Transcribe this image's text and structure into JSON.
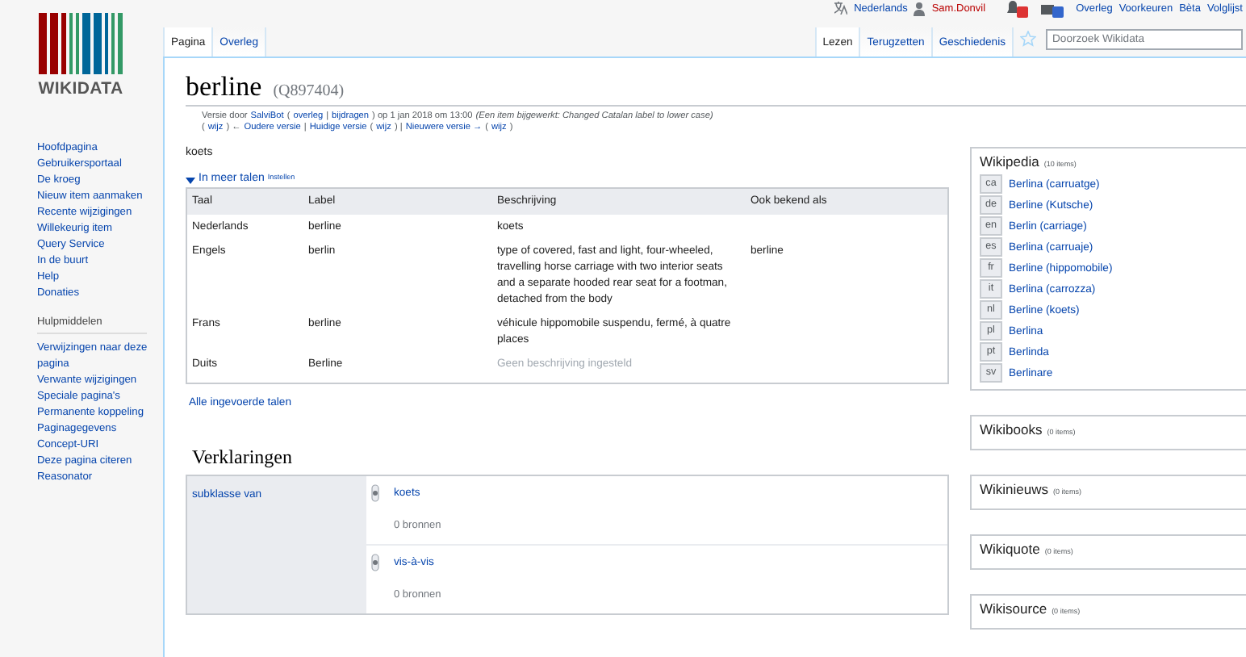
{
  "personal_tools": [
    {
      "kind": "language",
      "label": "Nederlands"
    },
    {
      "kind": "user",
      "label": "Sam.Donvil"
    },
    {
      "kind": "alerts"
    },
    {
      "kind": "notices"
    },
    {
      "kind": "link",
      "label": "Overleg"
    },
    {
      "kind": "link",
      "label": "Voorkeuren"
    },
    {
      "kind": "link",
      "label": "Bèta"
    },
    {
      "kind": "link",
      "label": "Volglijst"
    }
  ],
  "logo": {
    "text": "WIKIDATA"
  },
  "sidebar": {
    "navigation": [
      "Hoofdpagina",
      "Gebruikersportaal",
      "De kroeg",
      "Nieuw item aanmaken",
      "Recente wijzigingen",
      "Willekeurig item",
      "Query Service",
      "In de buurt",
      "Help",
      "Donaties"
    ],
    "tools_heading": "Hulpmiddelen",
    "tools": [
      "Verwijzingen naar deze pagina",
      "Verwante wijzigingen",
      "Speciale pagina's",
      "Permanente koppeling",
      "Paginagegevens",
      "Concept-URI",
      "Deze pagina citeren",
      "Reasonator"
    ]
  },
  "namespace_tabs": [
    {
      "label": "Pagina",
      "selected": true
    },
    {
      "label": "Overleg",
      "selected": false
    }
  ],
  "view_tabs": [
    {
      "label": "Lezen",
      "selected": true
    },
    {
      "label": "Terugzetten",
      "selected": false
    },
    {
      "label": "Geschiedenis",
      "selected": false
    }
  ],
  "watch": {
    "watched": false
  },
  "search": {
    "placeholder": "Doorzoek Wikidata"
  },
  "title": "berline",
  "item_id": "(Q897404)",
  "revision_lines": [
    [
      {
        "kind": "plain",
        "text": "Versie door"
      },
      {
        "kind": "link",
        "text": "SalviBot"
      },
      {
        "kind": "plain",
        "text": "("
      },
      {
        "kind": "link",
        "text": "overleg"
      },
      {
        "kind": "plain",
        "text": "|"
      },
      {
        "kind": "link",
        "text": "bijdragen"
      },
      {
        "kind": "plain",
        "text": ") op 1 jan 2018 om 13:00"
      },
      {
        "kind": "italic",
        "text": "(Een item bijgewerkt: Changed Catalan label to lower case)"
      }
    ],
    [
      {
        "kind": "plain",
        "text": "("
      },
      {
        "kind": "link",
        "text": "wijz"
      },
      {
        "kind": "plain",
        "text": ") ←"
      },
      {
        "kind": "link",
        "text": "Oudere versie"
      },
      {
        "kind": "plain",
        "text": "|"
      },
      {
        "kind": "link",
        "text": "Huidige versie"
      },
      {
        "kind": "plain",
        "text": "("
      },
      {
        "kind": "link",
        "text": "wijz"
      },
      {
        "kind": "plain",
        "text": ") |"
      },
      {
        "kind": "link",
        "text": "Nieuwere versie →"
      },
      {
        "kind": "plain",
        "text": "("
      },
      {
        "kind": "link",
        "text": "wijz"
      },
      {
        "kind": "plain",
        "text": ")"
      }
    ]
  ],
  "description": "koets",
  "terms": {
    "toggle": "In meer talen",
    "expanded": true,
    "settings": "Instellen",
    "columns": [
      "Taal",
      "Label",
      "Beschrijving",
      "Ook bekend als"
    ],
    "rows": [
      {
        "language": "Nederlands",
        "label": "berline",
        "description": "koets",
        "missing": false
      },
      {
        "language": "Engels",
        "label": "berlin",
        "description": "type of covered, fast and light, four-wheeled, travelling horse carriage with two interior seats and a separate hooded rear seat for a footman, detached from the body",
        "aliases": "berline",
        "missing": false
      },
      {
        "language": "Frans",
        "label": "berline",
        "description": "véhicule hippomobile suspendu, fermé, à quatre places",
        "missing": false
      },
      {
        "language": "Duits",
        "label": "Berline",
        "description": "Geen beschrijving ingesteld",
        "missing": true
      }
    ],
    "all_languages": "Alle ingevoerde talen"
  },
  "statements": {
    "heading": "Verklaringen",
    "groups": [
      {
        "property": "subklasse van",
        "values": [
          {
            "value": "koets",
            "references": "0 bronnen"
          },
          {
            "value": "vis-à-vis",
            "references": "0 bronnen"
          }
        ]
      }
    ]
  },
  "sitelink_groups": [
    {
      "name": "Wikipedia",
      "count": "(10 items)",
      "links": [
        {
          "code": "ca",
          "title": "Berlina (carruatge)"
        },
        {
          "code": "de",
          "title": "Berline (Kutsche)"
        },
        {
          "code": "en",
          "title": "Berlin (carriage)"
        },
        {
          "code": "es",
          "title": "Berlina (carruaje)"
        },
        {
          "code": "fr",
          "title": "Berline (hippomobile)"
        },
        {
          "code": "it",
          "title": "Berlina (carrozza)"
        },
        {
          "code": "nl",
          "title": "Berline (koets)"
        },
        {
          "code": "pl",
          "title": "Berlina"
        },
        {
          "code": "pt",
          "title": "Berlinda"
        },
        {
          "code": "sv",
          "title": "Berlinare"
        }
      ]
    },
    {
      "name": "Wikibooks",
      "count": "(0 items)"
    },
    {
      "name": "Wikinieuws",
      "count": "(0 items)"
    },
    {
      "name": "Wikiquote",
      "count": "(0 items)"
    },
    {
      "name": "Wikisource",
      "count": "(0 items)"
    }
  ]
}
